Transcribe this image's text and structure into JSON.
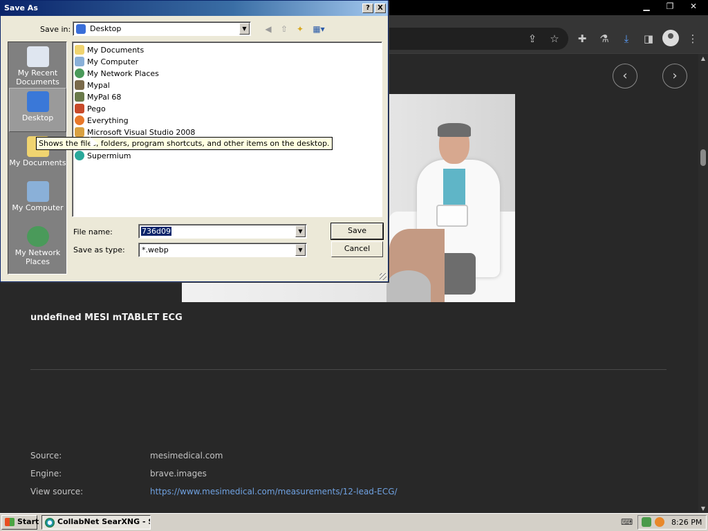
{
  "browser": {
    "nav_prev_icon": "‹",
    "nav_next_icon": "›",
    "image_title": "undefined MESI mTABLET ECG",
    "meta": [
      {
        "label": "Source:",
        "value": "mesimedical.com"
      },
      {
        "label": "Engine:",
        "value": "brave.images"
      },
      {
        "label": "View source:",
        "value": "https://www.mesimedical.com/measurements/12-lead-ECG/"
      }
    ]
  },
  "dialog": {
    "title": "Save As",
    "help_btn": "?",
    "close_btn": "X",
    "save_in_label": "Save in:",
    "save_in_value": "Desktop",
    "places": [
      {
        "label": "My Recent Documents"
      },
      {
        "label": "Desktop"
      },
      {
        "label": "My Documents"
      },
      {
        "label": "My Computer"
      },
      {
        "label": "My Network Places"
      }
    ],
    "files": [
      {
        "name": "My Documents"
      },
      {
        "name": "My Computer"
      },
      {
        "name": "My Network Places"
      },
      {
        "name": "Mypal"
      },
      {
        "name": "MyPal 68"
      },
      {
        "name": "Pego"
      },
      {
        "name": "Everything"
      },
      {
        "name": "Microsoft Visual Studio 2008"
      },
      {
        "name": ""
      },
      {
        "name": "Supermium"
      }
    ],
    "tooltip": "Shows the files, folders, program shortcuts, and other items on the desktop.",
    "file_name_label": "File name:",
    "file_name_value": "736d09",
    "save_type_label": "Save as type:",
    "save_type_value": "*.webp",
    "save_button": "Save",
    "cancel_button": "Cancel"
  },
  "taskbar": {
    "start_label": "Start",
    "task_label": "CollabNet SearXNG - S...",
    "clock": "8:26 PM"
  },
  "colors": {
    "link": "#6fa1e0",
    "title_bar_start": "#0a246a",
    "title_bar_end": "#a6caf0"
  }
}
